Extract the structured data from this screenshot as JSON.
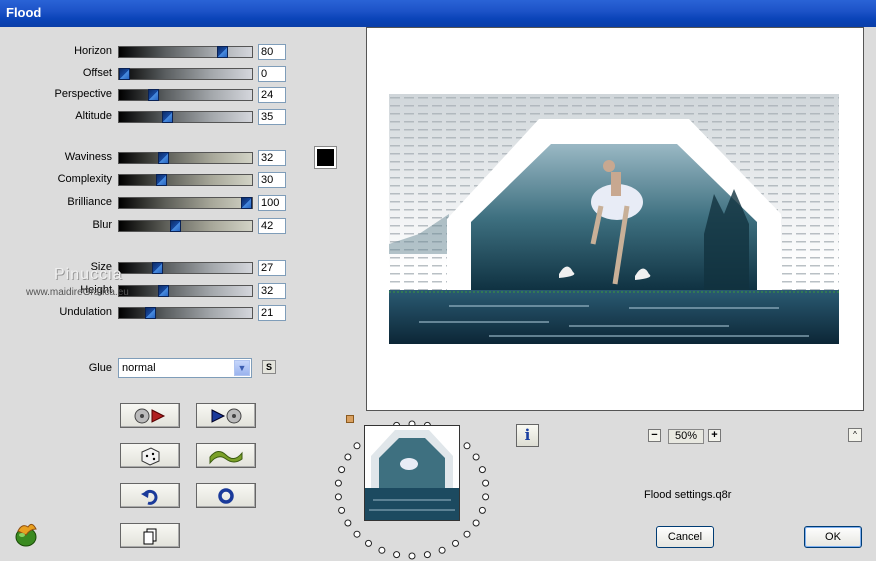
{
  "window": {
    "title": "Flood"
  },
  "parameters": [
    {
      "label": "Horizon",
      "value": "80",
      "pct": 0.8
    },
    {
      "label": "Offset",
      "value": "0",
      "pct": 0.0
    },
    {
      "label": "Perspective",
      "value": "24",
      "pct": 0.24
    },
    {
      "label": "Altitude",
      "value": "35",
      "pct": 0.35
    },
    {
      "label": "Waviness",
      "value": "32",
      "pct": 0.32
    },
    {
      "label": "Complexity",
      "value": "30",
      "pct": 0.3
    },
    {
      "label": "Brilliance",
      "value": "100",
      "pct": 1.0
    },
    {
      "label": "Blur",
      "value": "42",
      "pct": 0.42
    },
    {
      "label": "Size",
      "value": "27",
      "pct": 0.27
    },
    {
      "label": "Height",
      "value": "32",
      "pct": 0.32
    },
    {
      "label": "Undulation",
      "value": "21",
      "pct": 0.21
    }
  ],
  "color": {
    "value": "#000000"
  },
  "watermark": {
    "name": "Pinuccia",
    "url": "www.maidireGrafica.eu"
  },
  "glue": {
    "label": "Glue",
    "selected": "normal",
    "s_label": "S"
  },
  "tools": [
    "load-preset-icon",
    "save-preset-icon",
    "random-dice-icon",
    "wave-icon",
    "undo-icon",
    "reset-icon",
    "copy-icon"
  ],
  "preview": {
    "zoom": "50%",
    "zoom_minus": "−",
    "zoom_plus": "+",
    "collapse": "^"
  },
  "info": {
    "label": "i"
  },
  "status": {
    "settings_file": "Flood settings.q8r"
  },
  "buttons": {
    "cancel": "Cancel",
    "ok": "OK"
  },
  "colors": {
    "titlebar": "#0a44b8",
    "preview_bg": "#ffffff",
    "dialog_bg": "#dcdcdc"
  }
}
